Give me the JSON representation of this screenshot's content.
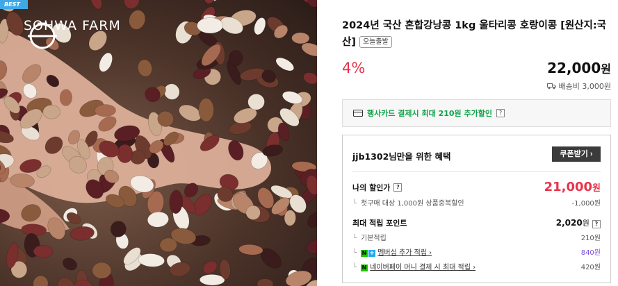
{
  "image": {
    "badge": "BEST",
    "brand": "SOHWA FARM",
    "brand_logo_icon": "sohwa-logo-icon"
  },
  "product": {
    "title": "2024년 국산 혼합강낭콩 1kg 울타리콩 호랑이콩 [원산지:국산]",
    "delivery_tag": "오늘출발",
    "discount": "4%",
    "price": "22,000",
    "currency": "원",
    "shipping": "배송비 3,000원"
  },
  "card_promo": {
    "text": "행사카드 결제시 최대 210원 추가할인",
    "help": "?"
  },
  "benefit": {
    "heading": "jjb1302님만을 위한 혜택",
    "coupon_button": "쿠폰받기 ›",
    "my_discount_label": "나의 할인가",
    "my_discount_help": "?",
    "my_discount_price": "21,000",
    "my_discount_currency": "원",
    "first_purchase_label": "첫구매 대상 1,000원 상품중복할인",
    "first_purchase_value": "-1,000원",
    "max_points_label": "최대 적립 포인트",
    "max_points_value": "2,020",
    "max_points_currency": "원",
    "max_points_help": "?",
    "basic_points_label": "기본적립",
    "basic_points_value": "210원",
    "membership_label": "멤버십 추가 적립 ›",
    "membership_value": "840원",
    "npay_money_label": "네이버페이 머니 결제 시 최대 적립 ›",
    "npay_money_value": "420원"
  },
  "colors": {
    "accent_red": "#e8334a",
    "naver_green": "#1ec800",
    "card_green": "#12a34a",
    "badge_blue": "#3fa9e8",
    "points_purple": "#7b4ed0"
  }
}
